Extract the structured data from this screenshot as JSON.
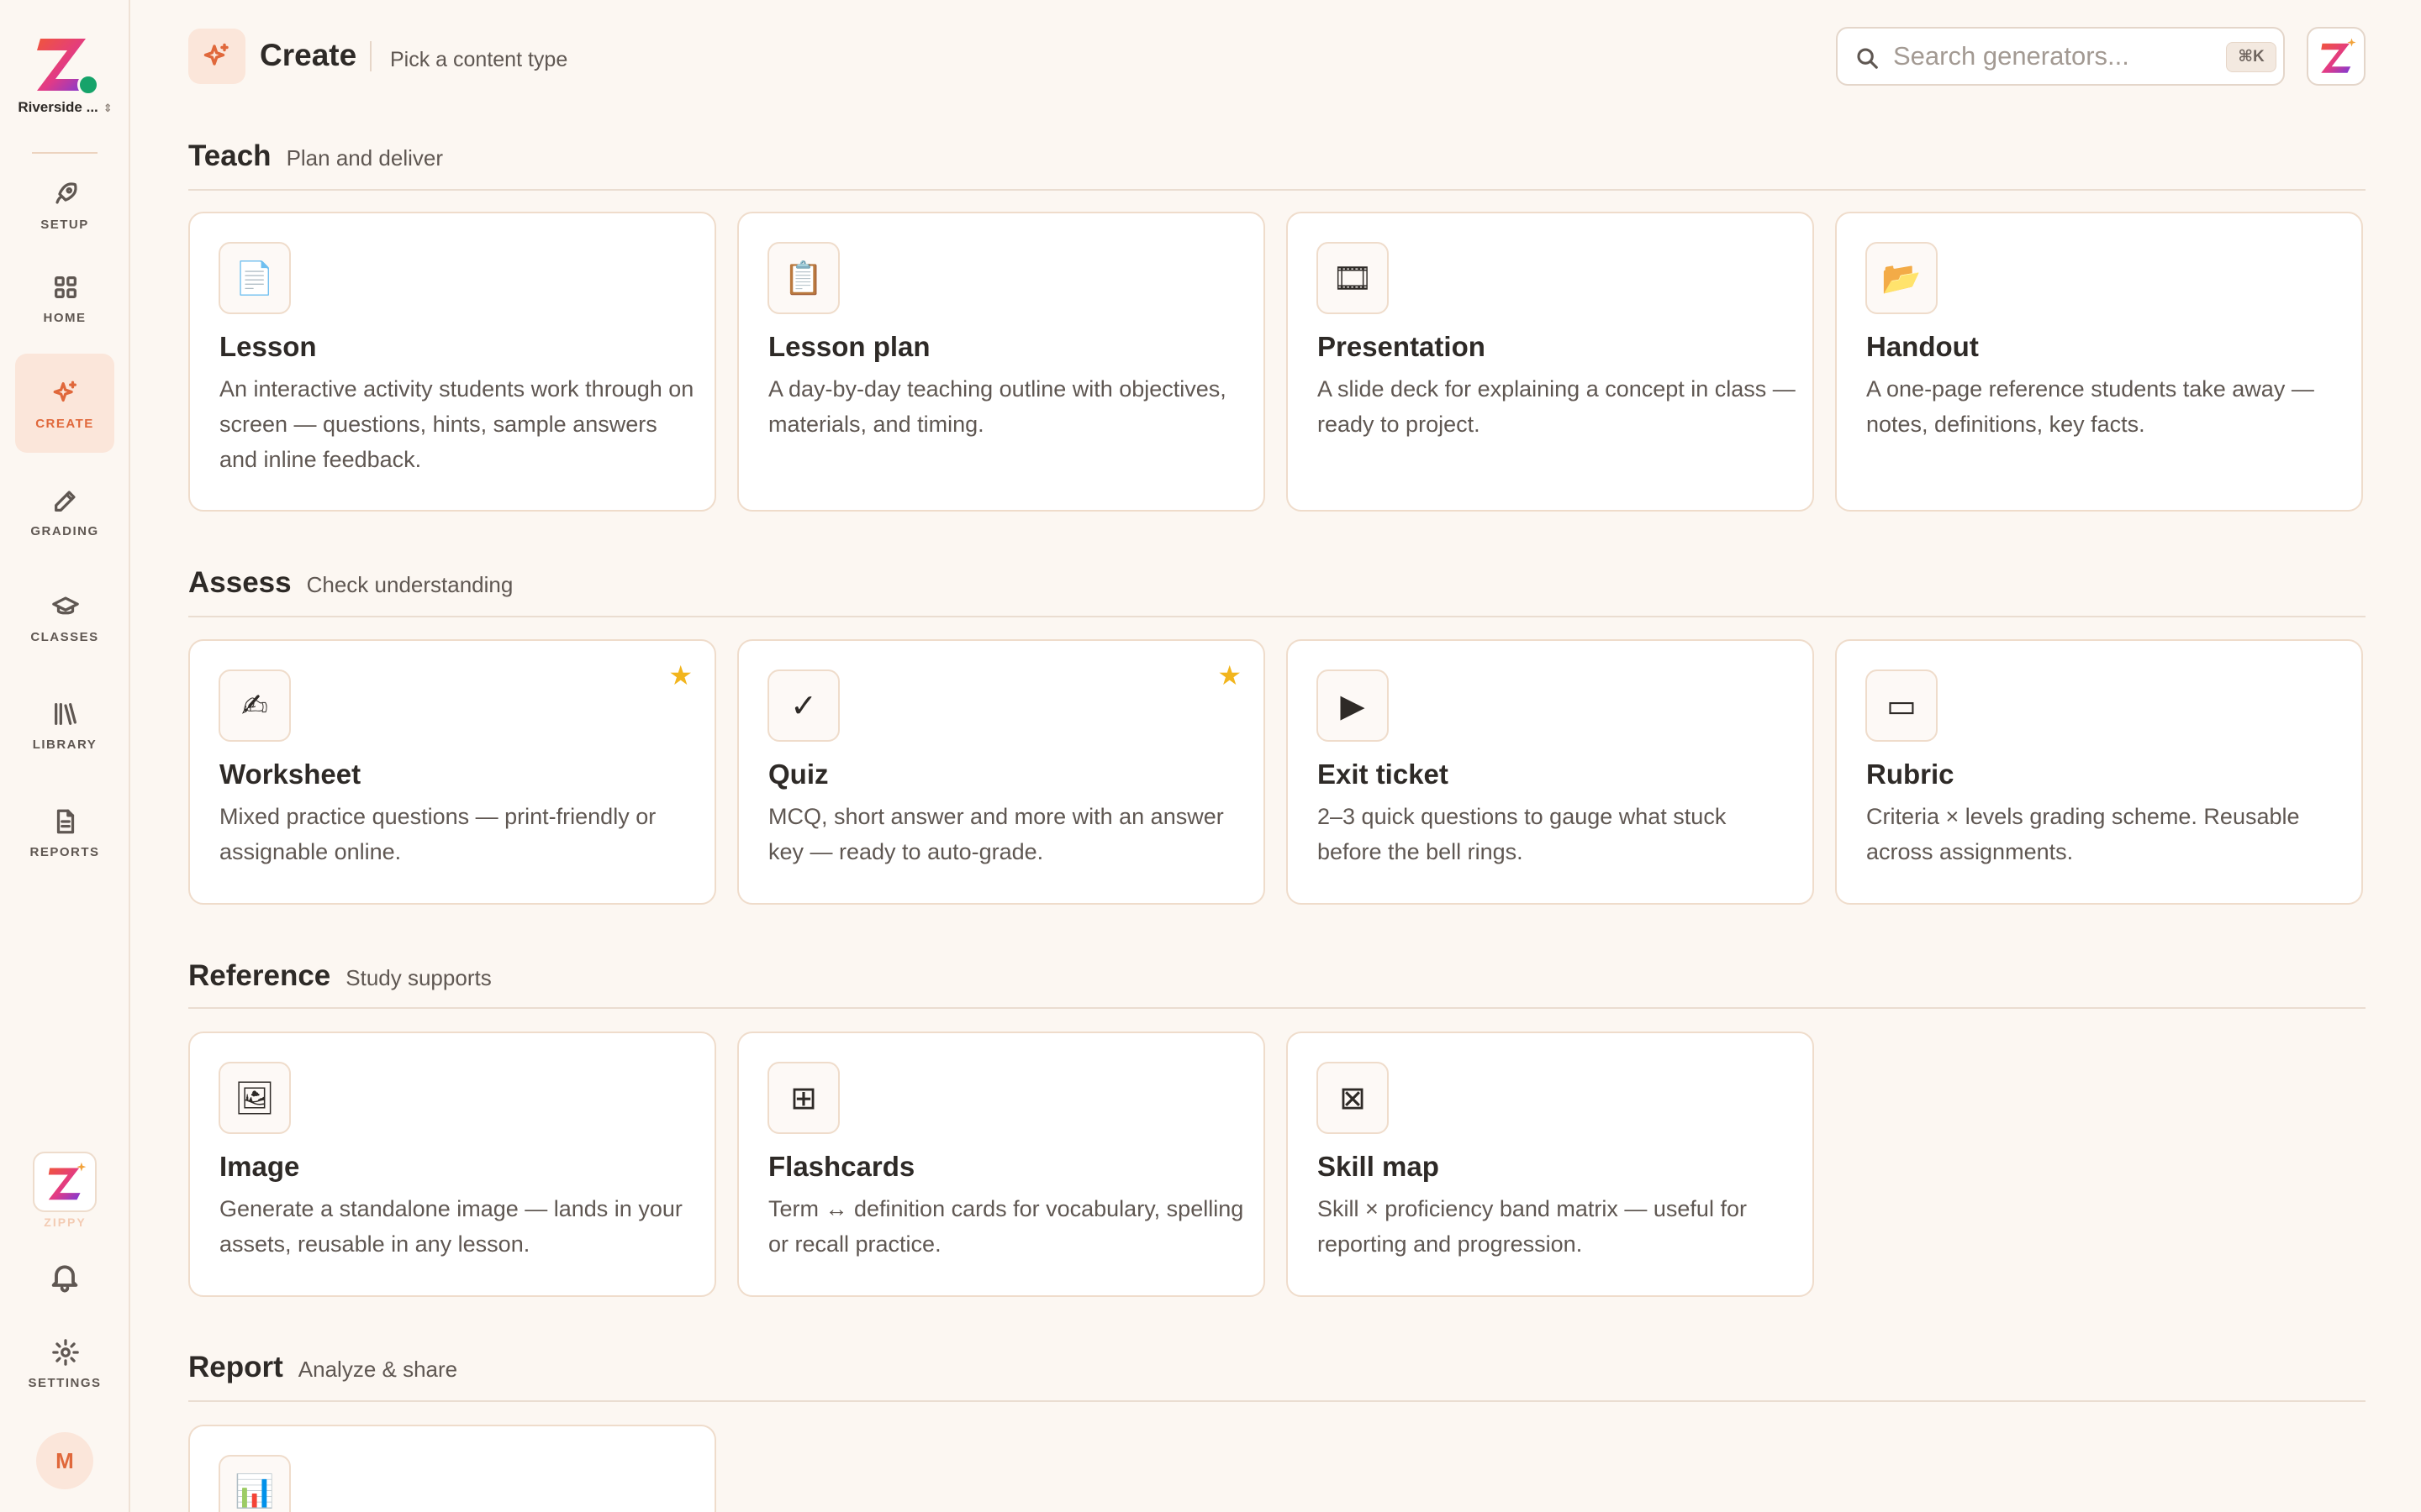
{
  "sidebar": {
    "workspace_name": "Riverside ...",
    "nav": [
      {
        "label": "SETUP",
        "icon": "rocket-icon"
      },
      {
        "label": "HOME",
        "icon": "grid-icon"
      },
      {
        "label": "CREATE",
        "icon": "sparkle-icon",
        "active": true
      },
      {
        "label": "GRADING",
        "icon": "pencil-icon"
      },
      {
        "label": "CLASSES",
        "icon": "graduation-cap-icon"
      },
      {
        "label": "LIBRARY",
        "icon": "books-icon"
      },
      {
        "label": "REPORTS",
        "icon": "document-icon"
      }
    ],
    "zippy_label": "ZIPPY",
    "settings_label": "SETTINGS",
    "avatar_initial": "M"
  },
  "header": {
    "title": "Create",
    "subtitle": "Pick a content type",
    "search_placeholder": "Search generators...",
    "search_shortcut": "⌘K"
  },
  "sections": [
    {
      "title": "Teach",
      "subtitle": "Plan and deliver",
      "cards": [
        {
          "title": "Lesson",
          "description": "An interactive activity students work through on screen — questions, hints, sample answers and inline feedback.",
          "icon": "page-icon",
          "glyph": "📄"
        },
        {
          "title": "Lesson plan",
          "description": "A day-by-day teaching outline with objectives, materials, and timing.",
          "icon": "clipboard-icon",
          "glyph": "📋"
        },
        {
          "title": "Presentation",
          "description": "A slide deck for explaining a concept in class — ready to project.",
          "icon": "film-icon",
          "glyph": "🎞"
        },
        {
          "title": "Handout",
          "description": "A one-page reference students take away — notes, definitions, key facts.",
          "icon": "folder-icon",
          "glyph": "📂"
        }
      ]
    },
    {
      "title": "Assess",
      "subtitle": "Check understanding",
      "cards": [
        {
          "title": "Worksheet",
          "description": "Mixed practice questions — print-friendly or assignable online.",
          "icon": "writing-hand-icon",
          "glyph": "✍",
          "starred": true
        },
        {
          "title": "Quiz",
          "description": "MCQ, short answer and more with an answer key — ready to auto-grade.",
          "icon": "check-icon",
          "glyph": "✓",
          "starred": true
        },
        {
          "title": "Exit ticket",
          "description": "2–3 quick questions to gauge what stuck before the bell rings.",
          "icon": "play-icon",
          "glyph": "▶"
        },
        {
          "title": "Rubric",
          "description": "Criteria × levels grading scheme. Reusable across assignments.",
          "icon": "rectangle-icon",
          "glyph": "▭"
        }
      ]
    },
    {
      "title": "Reference",
      "subtitle": "Study supports",
      "cards": [
        {
          "title": "Image",
          "description": "Generate a standalone image — lands in your assets, reusable in any lesson.",
          "icon": "picture-icon",
          "glyph": "🖼"
        },
        {
          "title": "Flashcards",
          "description": "Term ↔ definition cards for vocabulary, spelling or recall practice.",
          "icon": "squared-plus-icon",
          "glyph": "⊞"
        },
        {
          "title": "Skill map",
          "description": "Skill × proficiency band matrix — useful for reporting and progression.",
          "icon": "squared-x-icon",
          "glyph": "⊠"
        }
      ]
    },
    {
      "title": "Report",
      "subtitle": "Analyze & share",
      "cards": [
        {
          "title": "",
          "description": "",
          "icon": "bar-chart-icon",
          "glyph": "📊"
        }
      ]
    }
  ],
  "colors": {
    "accent": "#e0683b",
    "background": "#fcf7f2",
    "star": "#f2b51d",
    "online": "#16a36a"
  }
}
